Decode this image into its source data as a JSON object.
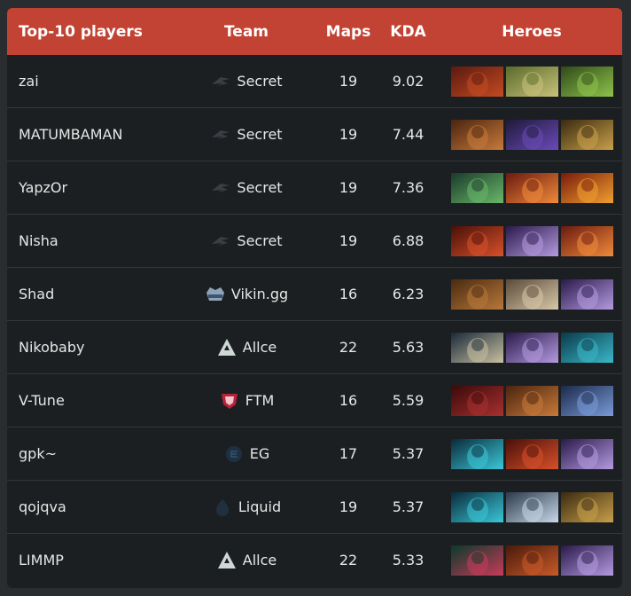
{
  "table": {
    "headers": {
      "player": "Top-10 players",
      "team": "Team",
      "maps": "Maps",
      "kda": "KDA",
      "heroes": "Heroes"
    },
    "rows": [
      {
        "player": "zai",
        "team": "Secret",
        "logo": "secret-logo-icon",
        "maps": "19",
        "kda": "9.02",
        "heroes": [
          "bloodseeker-portrait",
          "brewmaster-portrait",
          "venomancer-portrait"
        ]
      },
      {
        "player": "MATUMBAMAN",
        "team": "Secret",
        "logo": "secret-logo-icon",
        "maps": "19",
        "kda": "7.44",
        "heroes": [
          "juggernaut-portrait",
          "anti-mage-portrait",
          "monkey-king-portrait"
        ]
      },
      {
        "player": "YapzOr",
        "team": "Secret",
        "logo": "secret-logo-icon",
        "maps": "19",
        "kda": "7.36",
        "heroes": [
          "underlord-portrait",
          "lina-portrait",
          "phoenix-portrait"
        ]
      },
      {
        "player": "Nisha",
        "team": "Secret",
        "logo": "secret-logo-icon",
        "maps": "19",
        "kda": "6.88",
        "heroes": [
          "ember-spirit-portrait",
          "void-spirit-portrait",
          "lina-portrait"
        ]
      },
      {
        "player": "Shad",
        "team": "Vikin.gg",
        "logo": "vikin-logo-icon",
        "maps": "16",
        "kda": "6.23",
        "heroes": [
          "batrider-portrait",
          "pangolier-portrait",
          "void-spirit-portrait"
        ]
      },
      {
        "player": "Nikobaby",
        "team": "Allce",
        "logo": "alliance-logo-icon",
        "maps": "22",
        "kda": "5.63",
        "heroes": [
          "mirana-portrait",
          "void-spirit-portrait",
          "morphling-portrait"
        ]
      },
      {
        "player": "V-Tune",
        "team": "FTM",
        "logo": "ftm-logo-icon",
        "maps": "16",
        "kda": "5.59",
        "heroes": [
          "legion-commander-portrait",
          "juggernaut-portrait",
          "drow-ranger-portrait"
        ]
      },
      {
        "player": "gpk~",
        "team": "EG",
        "logo": "eg-logo-icon",
        "maps": "17",
        "kda": "5.37",
        "heroes": [
          "storm-spirit-portrait",
          "ember-spirit-portrait",
          "void-spirit-portrait"
        ]
      },
      {
        "player": "qojqva",
        "team": "Liquid",
        "logo": "liquid-logo-icon",
        "maps": "19",
        "kda": "5.37",
        "heroes": [
          "storm-spirit-portrait",
          "zeus-portrait",
          "monkey-king-portrait"
        ]
      },
      {
        "player": "LIMMP",
        "team": "Allce",
        "logo": "alliance-logo-icon",
        "maps": "22",
        "kda": "5.33",
        "heroes": [
          "dark-willow-portrait",
          "dragon-knight-portrait",
          "void-spirit-portrait"
        ]
      }
    ]
  },
  "colors": {
    "header_bg": "#c24333",
    "panel_bg": "#1c1f21",
    "row_divider": "#33373a",
    "text": "#e6e6e6"
  }
}
